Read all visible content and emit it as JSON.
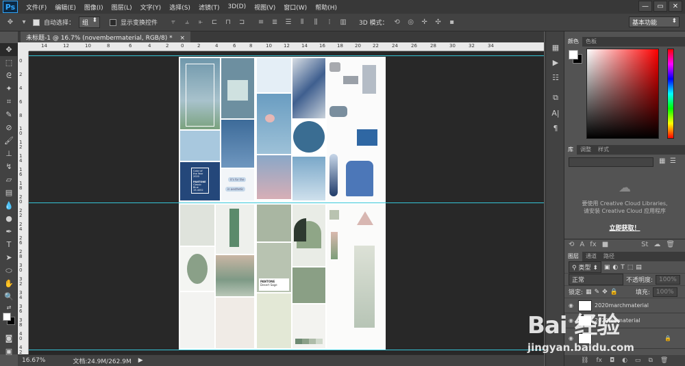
{
  "menubar": {
    "logo": "Ps",
    "items": [
      "文件(F)",
      "编辑(E)",
      "图像(I)",
      "图层(L)",
      "文字(Y)",
      "选择(S)",
      "滤镜(T)",
      "3D(D)",
      "视图(V)",
      "窗口(W)",
      "帮助(H)"
    ],
    "window_controls": [
      "—",
      "▭",
      "✕"
    ]
  },
  "options": {
    "auto_select_label": "自动选择：",
    "auto_select_value": "组",
    "show_transform_label": "显示变换控件",
    "mode_3d_label": "3D 模式：",
    "workspace": "基本功能"
  },
  "document": {
    "tab_title": "未标题-1 @ 16.7% (novembermaterial, RGB/8) *",
    "close": "×"
  },
  "ruler_top": [
    "14",
    "12",
    "10",
    "8",
    "6",
    "4",
    "2",
    "0",
    "2",
    "4",
    "6",
    "8",
    "10",
    "12",
    "14",
    "16",
    "18",
    "20",
    "22",
    "24",
    "26",
    "28",
    "30",
    "32",
    "34"
  ],
  "ruler_left": [
    "0",
    "2",
    "4",
    "6",
    "8",
    "1\n0",
    "1\n2",
    "1\n4",
    "1\n6",
    "1\n8",
    "2\n0",
    "2\n2",
    "2\n4",
    "2\n6",
    "2\n8",
    "3\n0",
    "3\n2",
    "3\n4",
    "3\n6",
    "3\n8",
    "4\n0",
    "4\n2"
  ],
  "status": {
    "zoom": "16.67%",
    "doc_info": "文档:24.9M/262.9M"
  },
  "panels": {
    "color_tabs": [
      "颜色",
      "色板"
    ],
    "lib_tabs": [
      "库",
      "调整",
      "样式"
    ],
    "lib_message_1": "要使用 Creative Cloud Libraries,",
    "lib_message_2": "请安装 Creative Cloud 应用程序",
    "lib_cta": "立即获取！",
    "layer_tabs": [
      "图层",
      "通道",
      "路径"
    ],
    "layer_filter": "类型",
    "blend_mode": "正常",
    "opacity_label": "不透明度:",
    "opacity_value": "100%",
    "lock_label": "锁定:",
    "fill_label": "填充:",
    "fill_value": "100%",
    "layers": [
      {
        "name": "2020marchmaterial"
      },
      {
        "name": "2020febmaterial"
      },
      {
        "name": ""
      }
    ]
  },
  "pantone_card": {
    "line1": "Color of",
    "line2": "the Year",
    "line3": "2020",
    "brand": "PANTONE",
    "name": "Classic Blue",
    "code": "19-4052"
  },
  "bubble1": "it's for the",
  "bubble2": "in aesthetic",
  "pantone_green": {
    "brand": "PANTONE",
    "name": "Desert Sage"
  },
  "watermark": {
    "logo": "Bai 经验",
    "url": "jingyan.baidu.com"
  },
  "colors": {
    "accent_guide": "#35c6d8",
    "blue_dark": "#24477a",
    "sage": "#9aae94"
  }
}
